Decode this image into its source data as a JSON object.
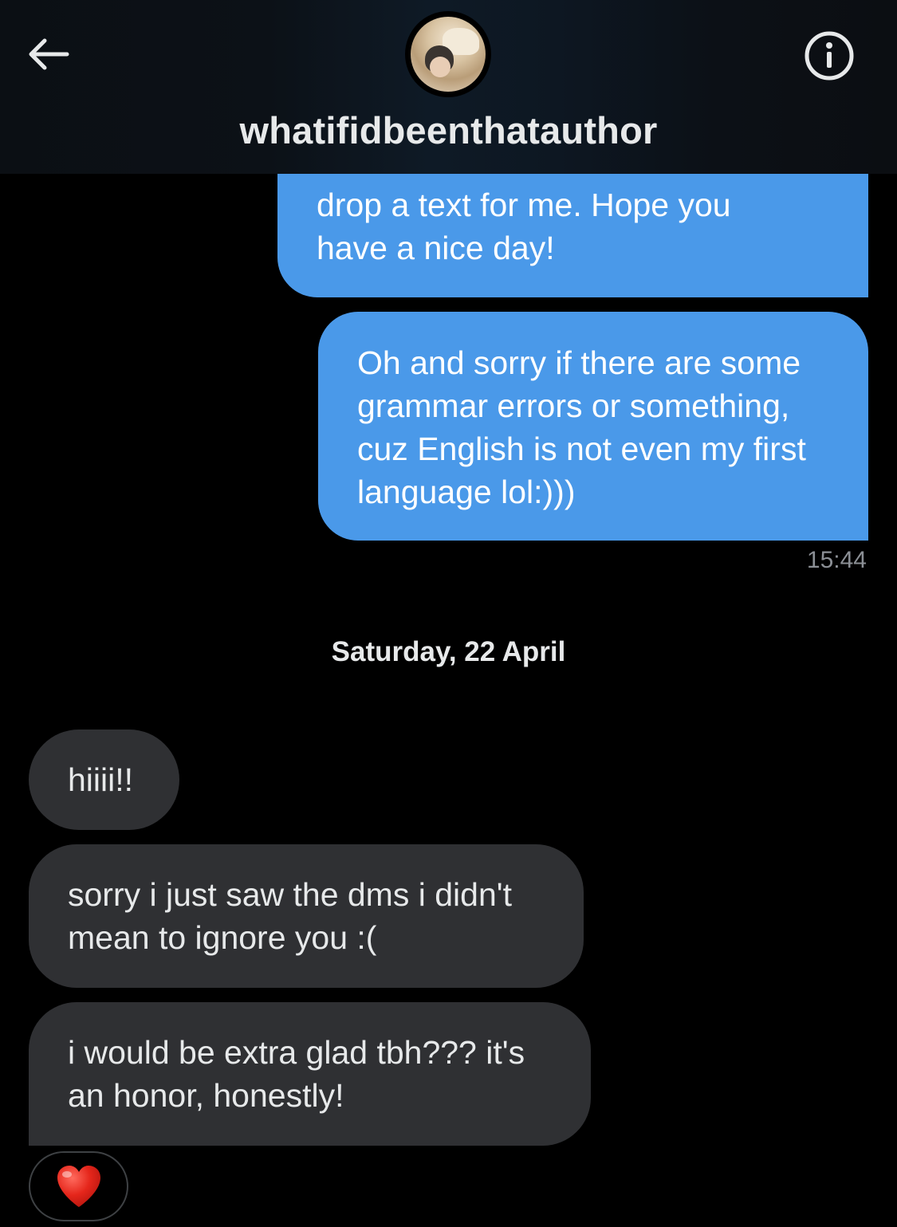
{
  "header": {
    "username": "whatifidbeenthatauthor",
    "back_icon": "arrow-left-icon",
    "info_icon": "info-circle-icon",
    "avatar_icon": "profile-avatar"
  },
  "messages": [
    {
      "direction": "sent",
      "lines": [
        "drop a text for me. Hope you",
        "have a nice day!"
      ]
    },
    {
      "direction": "sent",
      "lines": [
        "Oh and sorry if there are some",
        "grammar errors or something,",
        "cuz English is not even my first",
        "language lol:)))"
      ],
      "time": "15:44"
    },
    {
      "direction": "received",
      "lines": [
        "hiiii!!"
      ]
    },
    {
      "direction": "received",
      "lines": [
        "sorry i just saw the dms i didn't",
        "mean to ignore you :("
      ]
    },
    {
      "direction": "received",
      "lines": [
        "i would be extra glad tbh??? it's",
        "an honor, honestly!"
      ]
    }
  ],
  "date_separator": "Saturday, 22 April",
  "reaction": {
    "icon": "red-heart-icon",
    "emoji": "❤️"
  },
  "colors": {
    "sent_bubble": "#4a99e9",
    "received_bubble": "#2f3033",
    "background": "#000000",
    "timestamp": "#8b8f95"
  }
}
